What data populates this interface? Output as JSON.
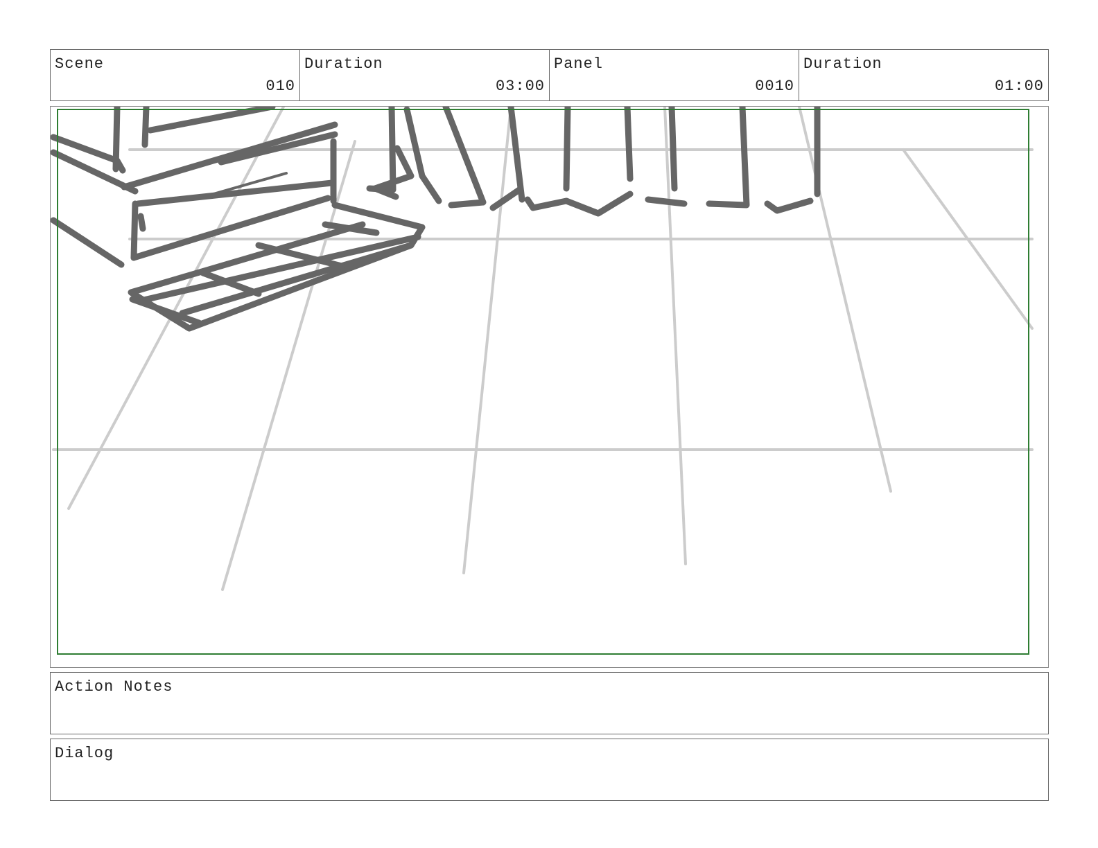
{
  "header": {
    "scene": {
      "label": "Scene",
      "value": "010"
    },
    "scene_duration": {
      "label": "Duration",
      "value": "03:00"
    },
    "panel": {
      "label": "Panel",
      "value": "0010"
    },
    "panel_duration": {
      "label": "Duration",
      "value": "01:00"
    }
  },
  "colors": {
    "safe_frame": "#2e7d32",
    "sketch_dark": "#666666",
    "sketch_light": "#cccccc"
  },
  "notes": {
    "action_label": "Action Notes",
    "dialog_label": "Dialog"
  }
}
